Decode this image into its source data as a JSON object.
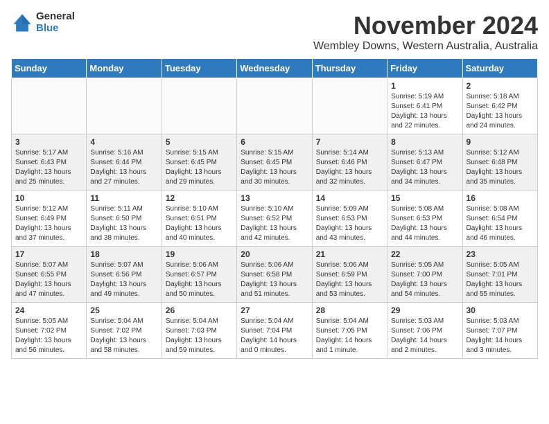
{
  "logo": {
    "general": "General",
    "blue": "Blue"
  },
  "title": "November 2024",
  "subtitle": "Wembley Downs, Western Australia, Australia",
  "days_of_week": [
    "Sunday",
    "Monday",
    "Tuesday",
    "Wednesday",
    "Thursday",
    "Friday",
    "Saturday"
  ],
  "weeks": [
    [
      {
        "day": "",
        "info": ""
      },
      {
        "day": "",
        "info": ""
      },
      {
        "day": "",
        "info": ""
      },
      {
        "day": "",
        "info": ""
      },
      {
        "day": "",
        "info": ""
      },
      {
        "day": "1",
        "info": "Sunrise: 5:19 AM\nSunset: 6:41 PM\nDaylight: 13 hours\nand 22 minutes."
      },
      {
        "day": "2",
        "info": "Sunrise: 5:18 AM\nSunset: 6:42 PM\nDaylight: 13 hours\nand 24 minutes."
      }
    ],
    [
      {
        "day": "3",
        "info": "Sunrise: 5:17 AM\nSunset: 6:43 PM\nDaylight: 13 hours\nand 25 minutes."
      },
      {
        "day": "4",
        "info": "Sunrise: 5:16 AM\nSunset: 6:44 PM\nDaylight: 13 hours\nand 27 minutes."
      },
      {
        "day": "5",
        "info": "Sunrise: 5:15 AM\nSunset: 6:45 PM\nDaylight: 13 hours\nand 29 minutes."
      },
      {
        "day": "6",
        "info": "Sunrise: 5:15 AM\nSunset: 6:45 PM\nDaylight: 13 hours\nand 30 minutes."
      },
      {
        "day": "7",
        "info": "Sunrise: 5:14 AM\nSunset: 6:46 PM\nDaylight: 13 hours\nand 32 minutes."
      },
      {
        "day": "8",
        "info": "Sunrise: 5:13 AM\nSunset: 6:47 PM\nDaylight: 13 hours\nand 34 minutes."
      },
      {
        "day": "9",
        "info": "Sunrise: 5:12 AM\nSunset: 6:48 PM\nDaylight: 13 hours\nand 35 minutes."
      }
    ],
    [
      {
        "day": "10",
        "info": "Sunrise: 5:12 AM\nSunset: 6:49 PM\nDaylight: 13 hours\nand 37 minutes."
      },
      {
        "day": "11",
        "info": "Sunrise: 5:11 AM\nSunset: 6:50 PM\nDaylight: 13 hours\nand 38 minutes."
      },
      {
        "day": "12",
        "info": "Sunrise: 5:10 AM\nSunset: 6:51 PM\nDaylight: 13 hours\nand 40 minutes."
      },
      {
        "day": "13",
        "info": "Sunrise: 5:10 AM\nSunset: 6:52 PM\nDaylight: 13 hours\nand 42 minutes."
      },
      {
        "day": "14",
        "info": "Sunrise: 5:09 AM\nSunset: 6:53 PM\nDaylight: 13 hours\nand 43 minutes."
      },
      {
        "day": "15",
        "info": "Sunrise: 5:08 AM\nSunset: 6:53 PM\nDaylight: 13 hours\nand 44 minutes."
      },
      {
        "day": "16",
        "info": "Sunrise: 5:08 AM\nSunset: 6:54 PM\nDaylight: 13 hours\nand 46 minutes."
      }
    ],
    [
      {
        "day": "17",
        "info": "Sunrise: 5:07 AM\nSunset: 6:55 PM\nDaylight: 13 hours\nand 47 minutes."
      },
      {
        "day": "18",
        "info": "Sunrise: 5:07 AM\nSunset: 6:56 PM\nDaylight: 13 hours\nand 49 minutes."
      },
      {
        "day": "19",
        "info": "Sunrise: 5:06 AM\nSunset: 6:57 PM\nDaylight: 13 hours\nand 50 minutes."
      },
      {
        "day": "20",
        "info": "Sunrise: 5:06 AM\nSunset: 6:58 PM\nDaylight: 13 hours\nand 51 minutes."
      },
      {
        "day": "21",
        "info": "Sunrise: 5:06 AM\nSunset: 6:59 PM\nDaylight: 13 hours\nand 53 minutes."
      },
      {
        "day": "22",
        "info": "Sunrise: 5:05 AM\nSunset: 7:00 PM\nDaylight: 13 hours\nand 54 minutes."
      },
      {
        "day": "23",
        "info": "Sunrise: 5:05 AM\nSunset: 7:01 PM\nDaylight: 13 hours\nand 55 minutes."
      }
    ],
    [
      {
        "day": "24",
        "info": "Sunrise: 5:05 AM\nSunset: 7:02 PM\nDaylight: 13 hours\nand 56 minutes."
      },
      {
        "day": "25",
        "info": "Sunrise: 5:04 AM\nSunset: 7:02 PM\nDaylight: 13 hours\nand 58 minutes."
      },
      {
        "day": "26",
        "info": "Sunrise: 5:04 AM\nSunset: 7:03 PM\nDaylight: 13 hours\nand 59 minutes."
      },
      {
        "day": "27",
        "info": "Sunrise: 5:04 AM\nSunset: 7:04 PM\nDaylight: 14 hours\nand 0 minutes."
      },
      {
        "day": "28",
        "info": "Sunrise: 5:04 AM\nSunset: 7:05 PM\nDaylight: 14 hours\nand 1 minute."
      },
      {
        "day": "29",
        "info": "Sunrise: 5:03 AM\nSunset: 7:06 PM\nDaylight: 14 hours\nand 2 minutes."
      },
      {
        "day": "30",
        "info": "Sunrise: 5:03 AM\nSunset: 7:07 PM\nDaylight: 14 hours\nand 3 minutes."
      }
    ]
  ]
}
